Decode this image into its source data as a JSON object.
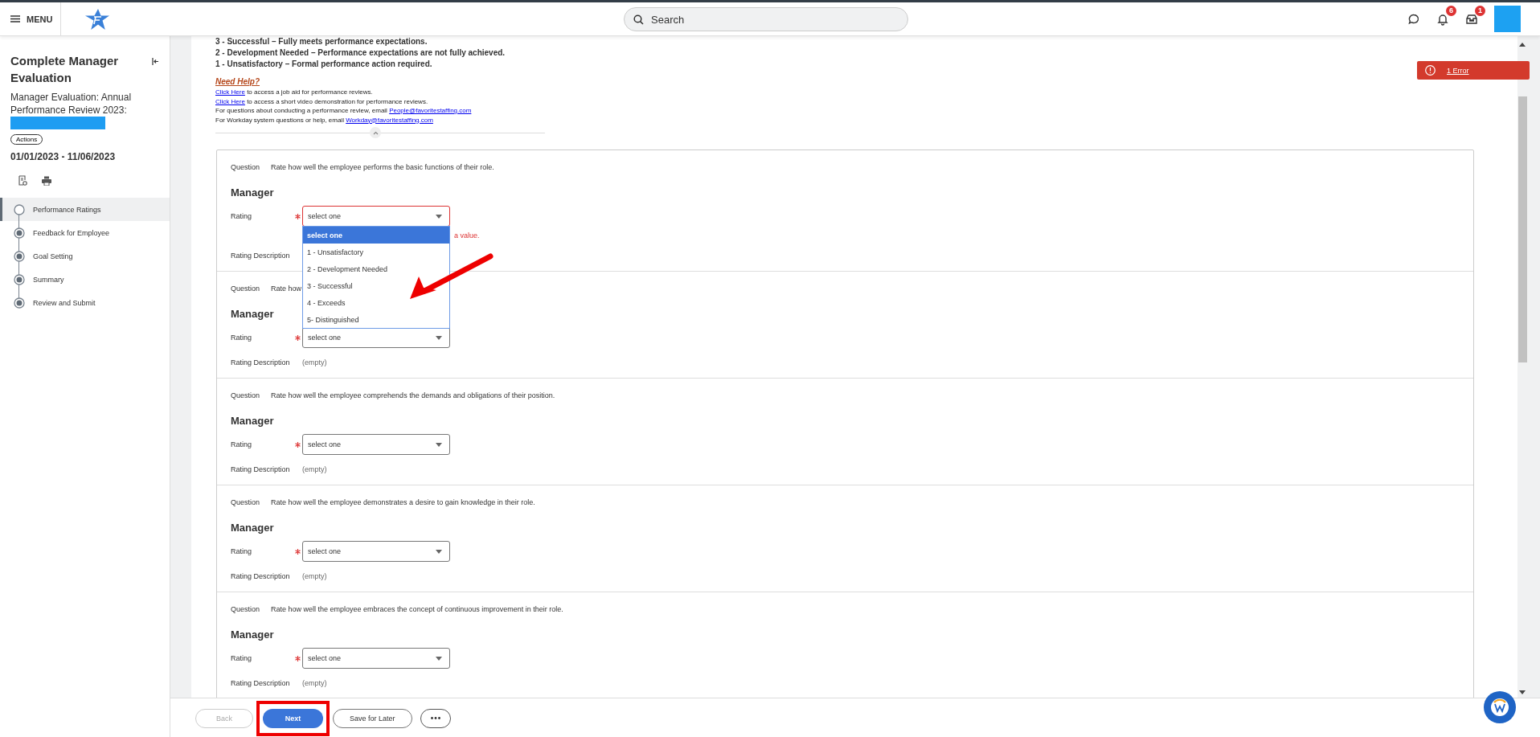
{
  "header": {
    "menu_label": "MENU",
    "search": {
      "placeholder": "Search"
    },
    "notifications_badge": "6",
    "inbox_badge": "1"
  },
  "sidebar": {
    "title": "Complete Manager Evaluation",
    "subtitle": "Manager Evaluation: Annual Performance Review 2023:",
    "actions_label": "Actions",
    "period": "01/01/2023 - 11/06/2023",
    "steps": [
      {
        "label": "Performance Ratings",
        "selected": true
      },
      {
        "label": "Feedback for Employee",
        "selected": false
      },
      {
        "label": "Goal Setting",
        "selected": false
      },
      {
        "label": "Summary",
        "selected": false
      },
      {
        "label": "Review and Submit",
        "selected": false
      }
    ]
  },
  "intro": {
    "rating_scale": [
      "3 - Successful – Fully meets performance expectations.",
      "2 - Development Needed – Performance expectations are not fully achieved.",
      "1 - Unsatisfactory – Formal performance action required."
    ],
    "help_heading": "Need Help?",
    "help_lines": [
      [
        {
          "kind": "link",
          "text": "Click Here"
        },
        {
          "kind": "text",
          "text": " to access a job aid for performance reviews."
        }
      ],
      [
        {
          "kind": "link",
          "text": "Click Here"
        },
        {
          "kind": "text",
          "text": " to access a short video demonstration for performance reviews."
        }
      ],
      [
        {
          "kind": "text",
          "text": "For questions about conducting a performance review, email "
        },
        {
          "kind": "link",
          "text": "People@favoritestaffing.com"
        }
      ],
      [
        {
          "kind": "text",
          "text": "For Workday system questions or help, email "
        },
        {
          "kind": "link",
          "text": "Workday@favoritestaffing.com "
        }
      ]
    ]
  },
  "error_banner": "1 Error",
  "questions": [
    {
      "label": "Question",
      "text": "Rate how well the employee performs the basic functions of their role.",
      "section": "Manager",
      "rating_label": "Rating",
      "required": true,
      "value": "select one",
      "invalid": true,
      "error": "a value.",
      "description_label": "Rating Description",
      "dropdown": [
        {
          "label": "select one",
          "selected": true
        },
        {
          "label": "1 - Unsatisfactory",
          "selected": false
        },
        {
          "label": "2 - Development Needed",
          "selected": false
        },
        {
          "label": "3 - Successful",
          "selected": false
        },
        {
          "label": "4 - Exceeds",
          "selected": false
        },
        {
          "label": "5- Distinguished",
          "selected": false
        }
      ]
    },
    {
      "label": "Question",
      "text": "Rate how",
      "section": "Manager",
      "rating_label": "Rating",
      "required": true,
      "value": "select one",
      "invalid": false,
      "description_label": "Rating Description",
      "description": "(empty)"
    },
    {
      "label": "Question",
      "text": "Rate how well the employee comprehends the demands and obligations of their position.",
      "section": "Manager",
      "rating_label": "Rating",
      "required": true,
      "value": "select one",
      "invalid": false,
      "description_label": "Rating Description",
      "description": "(empty)"
    },
    {
      "label": "Question",
      "text": "Rate how well the employee demonstrates a desire to gain knowledge in their role.",
      "section": "Manager",
      "rating_label": "Rating",
      "required": true,
      "value": "select one",
      "invalid": false,
      "description_label": "Rating Description",
      "description": "(empty)"
    },
    {
      "label": "Question",
      "text": "Rate how well the employee embraces the concept of continuous improvement in their role.",
      "section": "Manager",
      "rating_label": "Rating",
      "required": true,
      "value": "select one",
      "invalid": false,
      "description_label": "Rating Description",
      "description": "(empty)"
    }
  ],
  "footer": {
    "buttons": [
      {
        "kind": "secondary",
        "label": "Back",
        "disabled": true,
        "highlighted": false
      },
      {
        "kind": "primary",
        "label": "Next",
        "disabled": false,
        "highlighted": true
      },
      {
        "kind": "secondary",
        "label": "Save for Later",
        "disabled": false,
        "highlighted": false
      },
      {
        "kind": "more",
        "disabled": false,
        "highlighted": false
      }
    ]
  }
}
